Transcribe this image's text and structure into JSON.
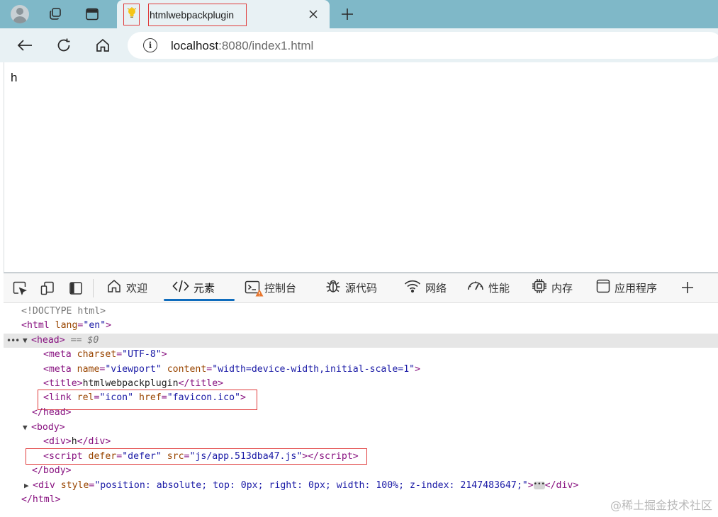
{
  "tab": {
    "title": "htmlwebpackplugin",
    "favicon": "lightbulb-icon"
  },
  "address_bar": {
    "host": "localhost",
    "rest": ":8080/index1.html"
  },
  "page": {
    "content": "h"
  },
  "devtools": {
    "tabs": [
      {
        "label": "欢迎",
        "icon": "home-icon"
      },
      {
        "label": "元素",
        "icon": "code-icon",
        "active": true
      },
      {
        "label": "控制台",
        "icon": "console-icon"
      },
      {
        "label": "源代码",
        "icon": "bug-icon"
      },
      {
        "label": "网络",
        "icon": "wifi-icon"
      },
      {
        "label": "性能",
        "icon": "gauge-icon"
      },
      {
        "label": "内存",
        "icon": "chip-icon"
      },
      {
        "label": "应用程序",
        "icon": "app-icon"
      }
    ],
    "tree": {
      "doctype": "<!DOCTYPE html>",
      "html_open": "<html",
      "html_lang_attr": "lang",
      "html_lang_val": "\"en\"",
      "head_tag": "<head>",
      "head_marker": "== $0",
      "meta1_attr": "charset",
      "meta1_val": "\"UTF-8\"",
      "meta2_name_val": "\"viewport\"",
      "meta2_content_val": "\"width=device-width,initial-scale=1\"",
      "title_text": "htmlwebpackplugin",
      "link_rel_val": "\"icon\"",
      "link_href_val": "\"favicon.ico\"",
      "div_text": "h",
      "script_defer_val": "\"defer\"",
      "script_src_val": "\"js/app.513dba47.js\"",
      "style_val": "\"position: absolute; top: 0px; right: 0px; width: 100%; z-index: 2147483647;\""
    }
  },
  "watermark": "@稀土掘金技术社区",
  "colors": {
    "tabstrip": "#7fb8c8",
    "toolbar": "#e8f1f4",
    "highlight_box": "#e03b3b",
    "active_underline": "#0f6cbd",
    "tag": "#881280",
    "attr": "#994500",
    "value": "#1a1aa6"
  }
}
